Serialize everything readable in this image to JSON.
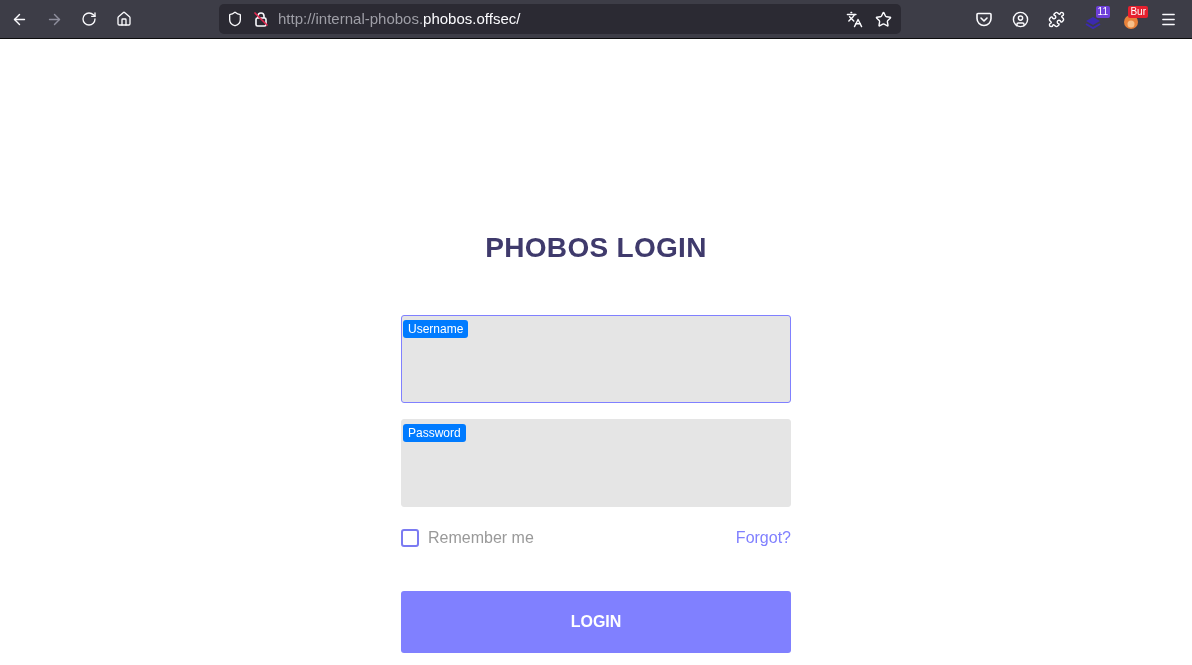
{
  "browser": {
    "back_button": {
      "disabled": false
    },
    "forward_button": {
      "disabled": true
    },
    "address_bar": {
      "url_start": "http://internal-phobos.",
      "url_host": "phobos.offsec/"
    },
    "extensions": [
      {
        "badge": "11",
        "color": "#6d3fd8"
      },
      {
        "badge": "Bur",
        "color": "#e5202e"
      }
    ]
  },
  "login": {
    "title": "PHOBOS LOGIN",
    "fields": [
      {
        "label": "Username",
        "focused": true
      },
      {
        "label": "Password",
        "focused": false
      }
    ],
    "remember": {
      "label": "Remember me",
      "checked": false
    },
    "forgot_link": "Forgot?",
    "submit_button": "LOGIN"
  }
}
